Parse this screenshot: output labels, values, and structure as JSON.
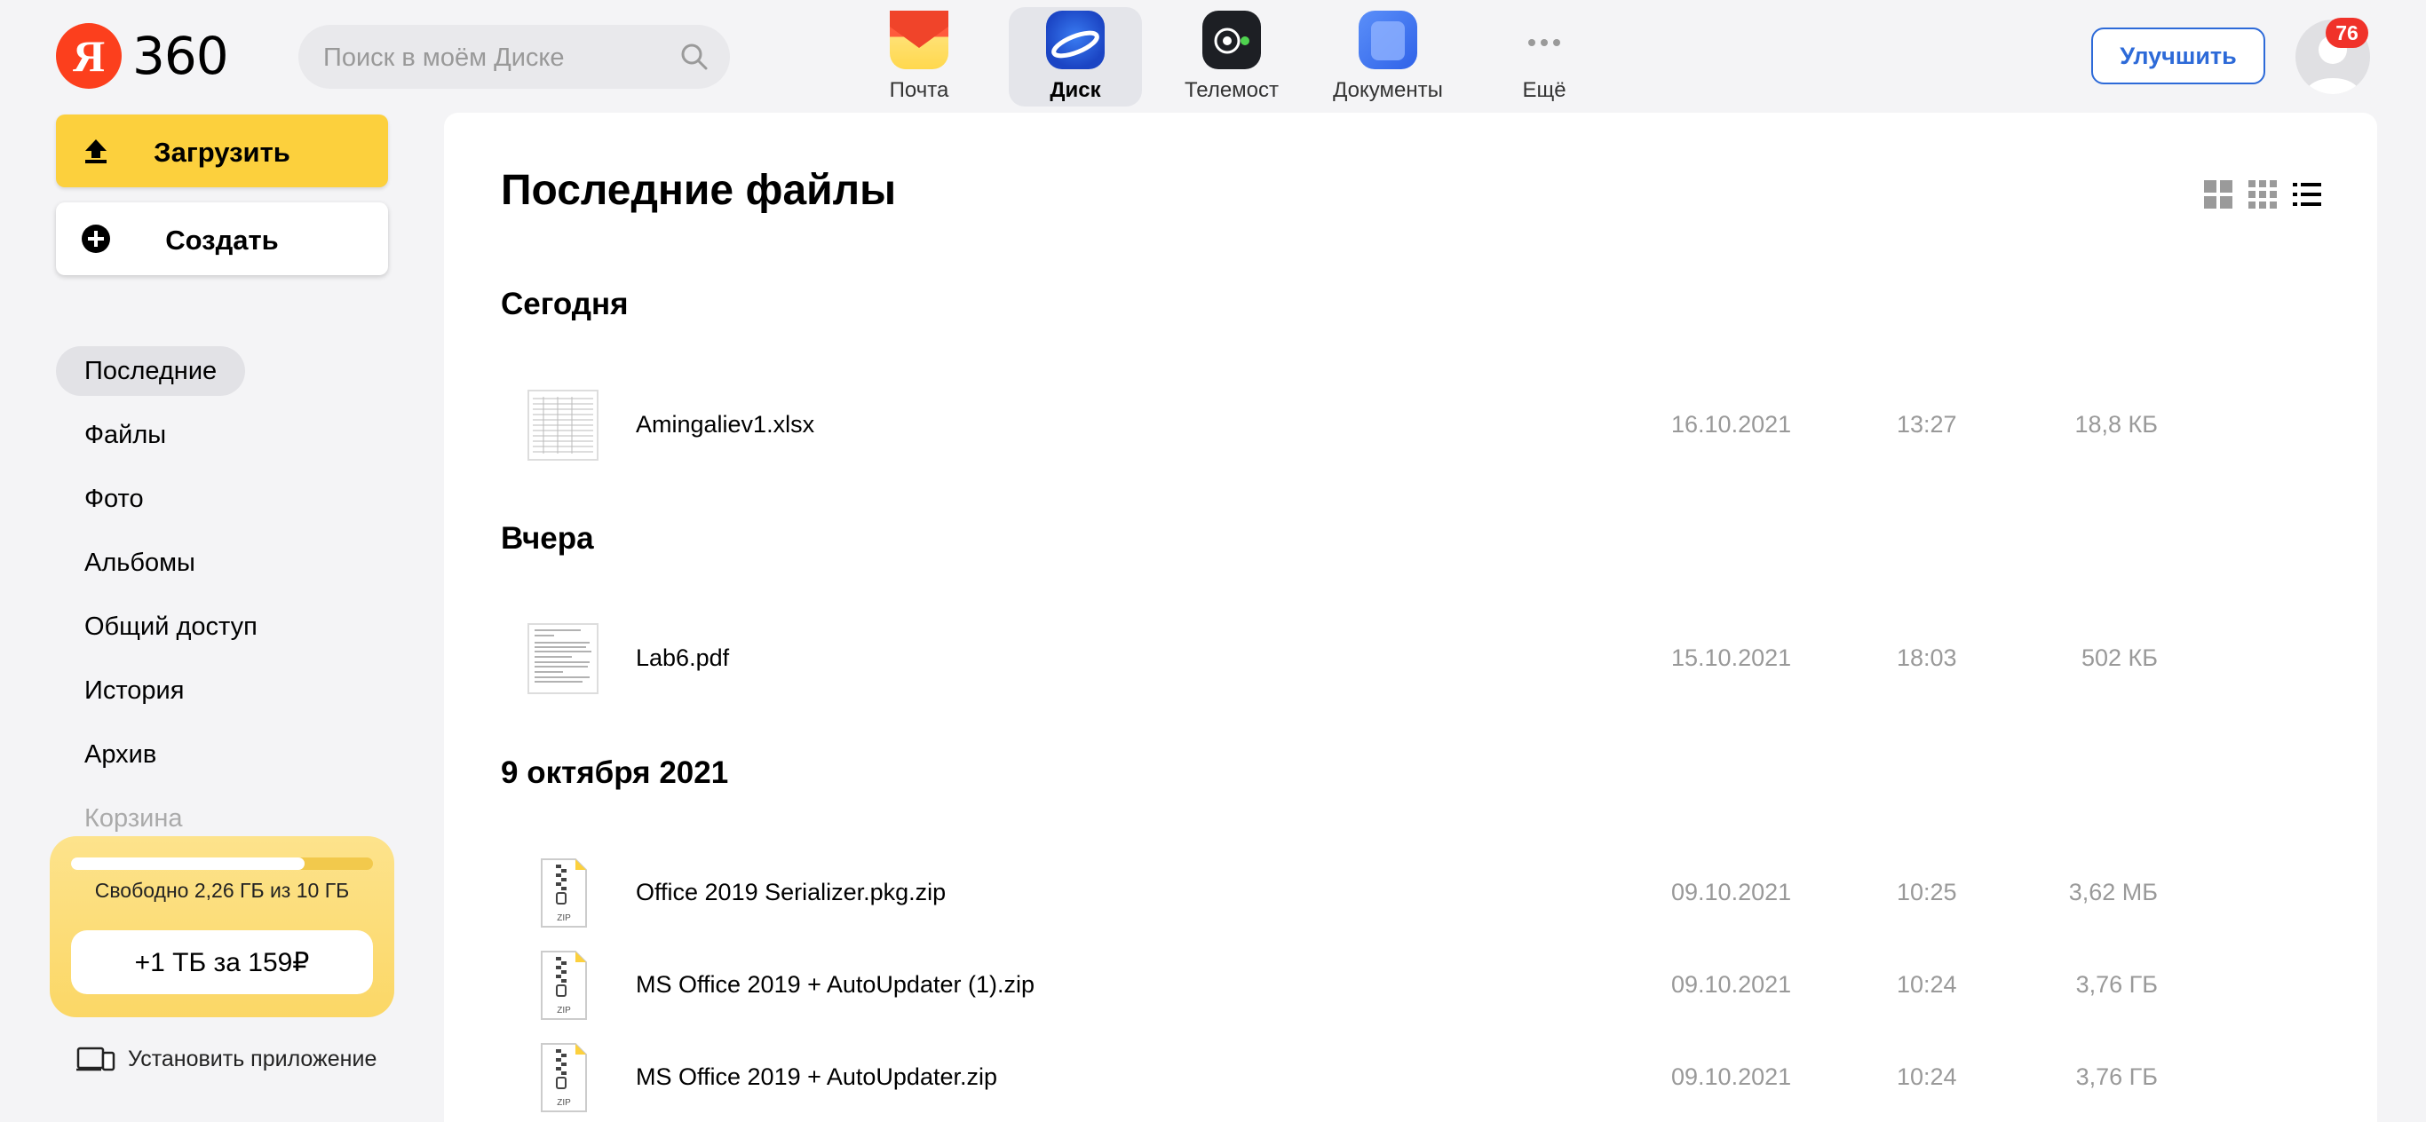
{
  "header": {
    "logo_text": "360",
    "logo_letter": "Я",
    "search_placeholder": "Поиск в моём Диске",
    "apps": [
      {
        "label": "Почта",
        "icon": "mail-icon"
      },
      {
        "label": "Диск",
        "icon": "disk-icon",
        "active": true
      },
      {
        "label": "Телемост",
        "icon": "telemost-icon"
      },
      {
        "label": "Документы",
        "icon": "documents-icon"
      },
      {
        "label": "Ещё",
        "icon": "more-icon"
      }
    ],
    "upgrade_label": "Улучшить",
    "notifications_count": "76"
  },
  "sidebar": {
    "upload_label": "Загрузить",
    "create_label": "Создать",
    "nav": [
      {
        "label": "Последние",
        "active": true
      },
      {
        "label": "Файлы"
      },
      {
        "label": "Фото"
      },
      {
        "label": "Альбомы"
      },
      {
        "label": "Общий доступ"
      },
      {
        "label": "История"
      },
      {
        "label": "Архив"
      },
      {
        "label": "Корзина"
      }
    ],
    "storage": {
      "text": "Свободно 2,26 ГБ из 10 ГБ",
      "used_fraction": 0.774,
      "buy_label": "+1 ТБ за 159₽"
    },
    "install_label": "Установить приложение"
  },
  "main": {
    "title": "Последние файлы",
    "groups": [
      {
        "title": "Сегодня",
        "files": [
          {
            "name": "Amingaliev1.xlsx",
            "date": "16.10.2021",
            "time": "13:27",
            "size": "18,8 КБ",
            "type": "xlsx"
          }
        ]
      },
      {
        "title": "Вчера",
        "files": [
          {
            "name": "Lab6.pdf",
            "date": "15.10.2021",
            "time": "18:03",
            "size": "502 КБ",
            "type": "pdf"
          }
        ]
      },
      {
        "title": "9 октября 2021",
        "files": [
          {
            "name": "Office 2019 Serializer.pkg.zip",
            "date": "09.10.2021",
            "time": "10:25",
            "size": "3,62 МБ",
            "type": "zip",
            "type_label": "ZIP"
          },
          {
            "name": "MS Office 2019 + AutoUpdater (1).zip",
            "date": "09.10.2021",
            "time": "10:24",
            "size": "3,76 ГБ",
            "type": "zip",
            "type_label": "ZIP"
          },
          {
            "name": "MS Office 2019 + AutoUpdater.zip",
            "date": "09.10.2021",
            "time": "10:24",
            "size": "3,76 ГБ",
            "type": "zip",
            "type_label": "ZIP"
          }
        ]
      }
    ]
  },
  "colors": {
    "brand_red": "#fc3f1d",
    "upload_yellow": "#fcd03d",
    "accent_blue": "#2d6ad8",
    "badge_red": "#f0322a"
  }
}
